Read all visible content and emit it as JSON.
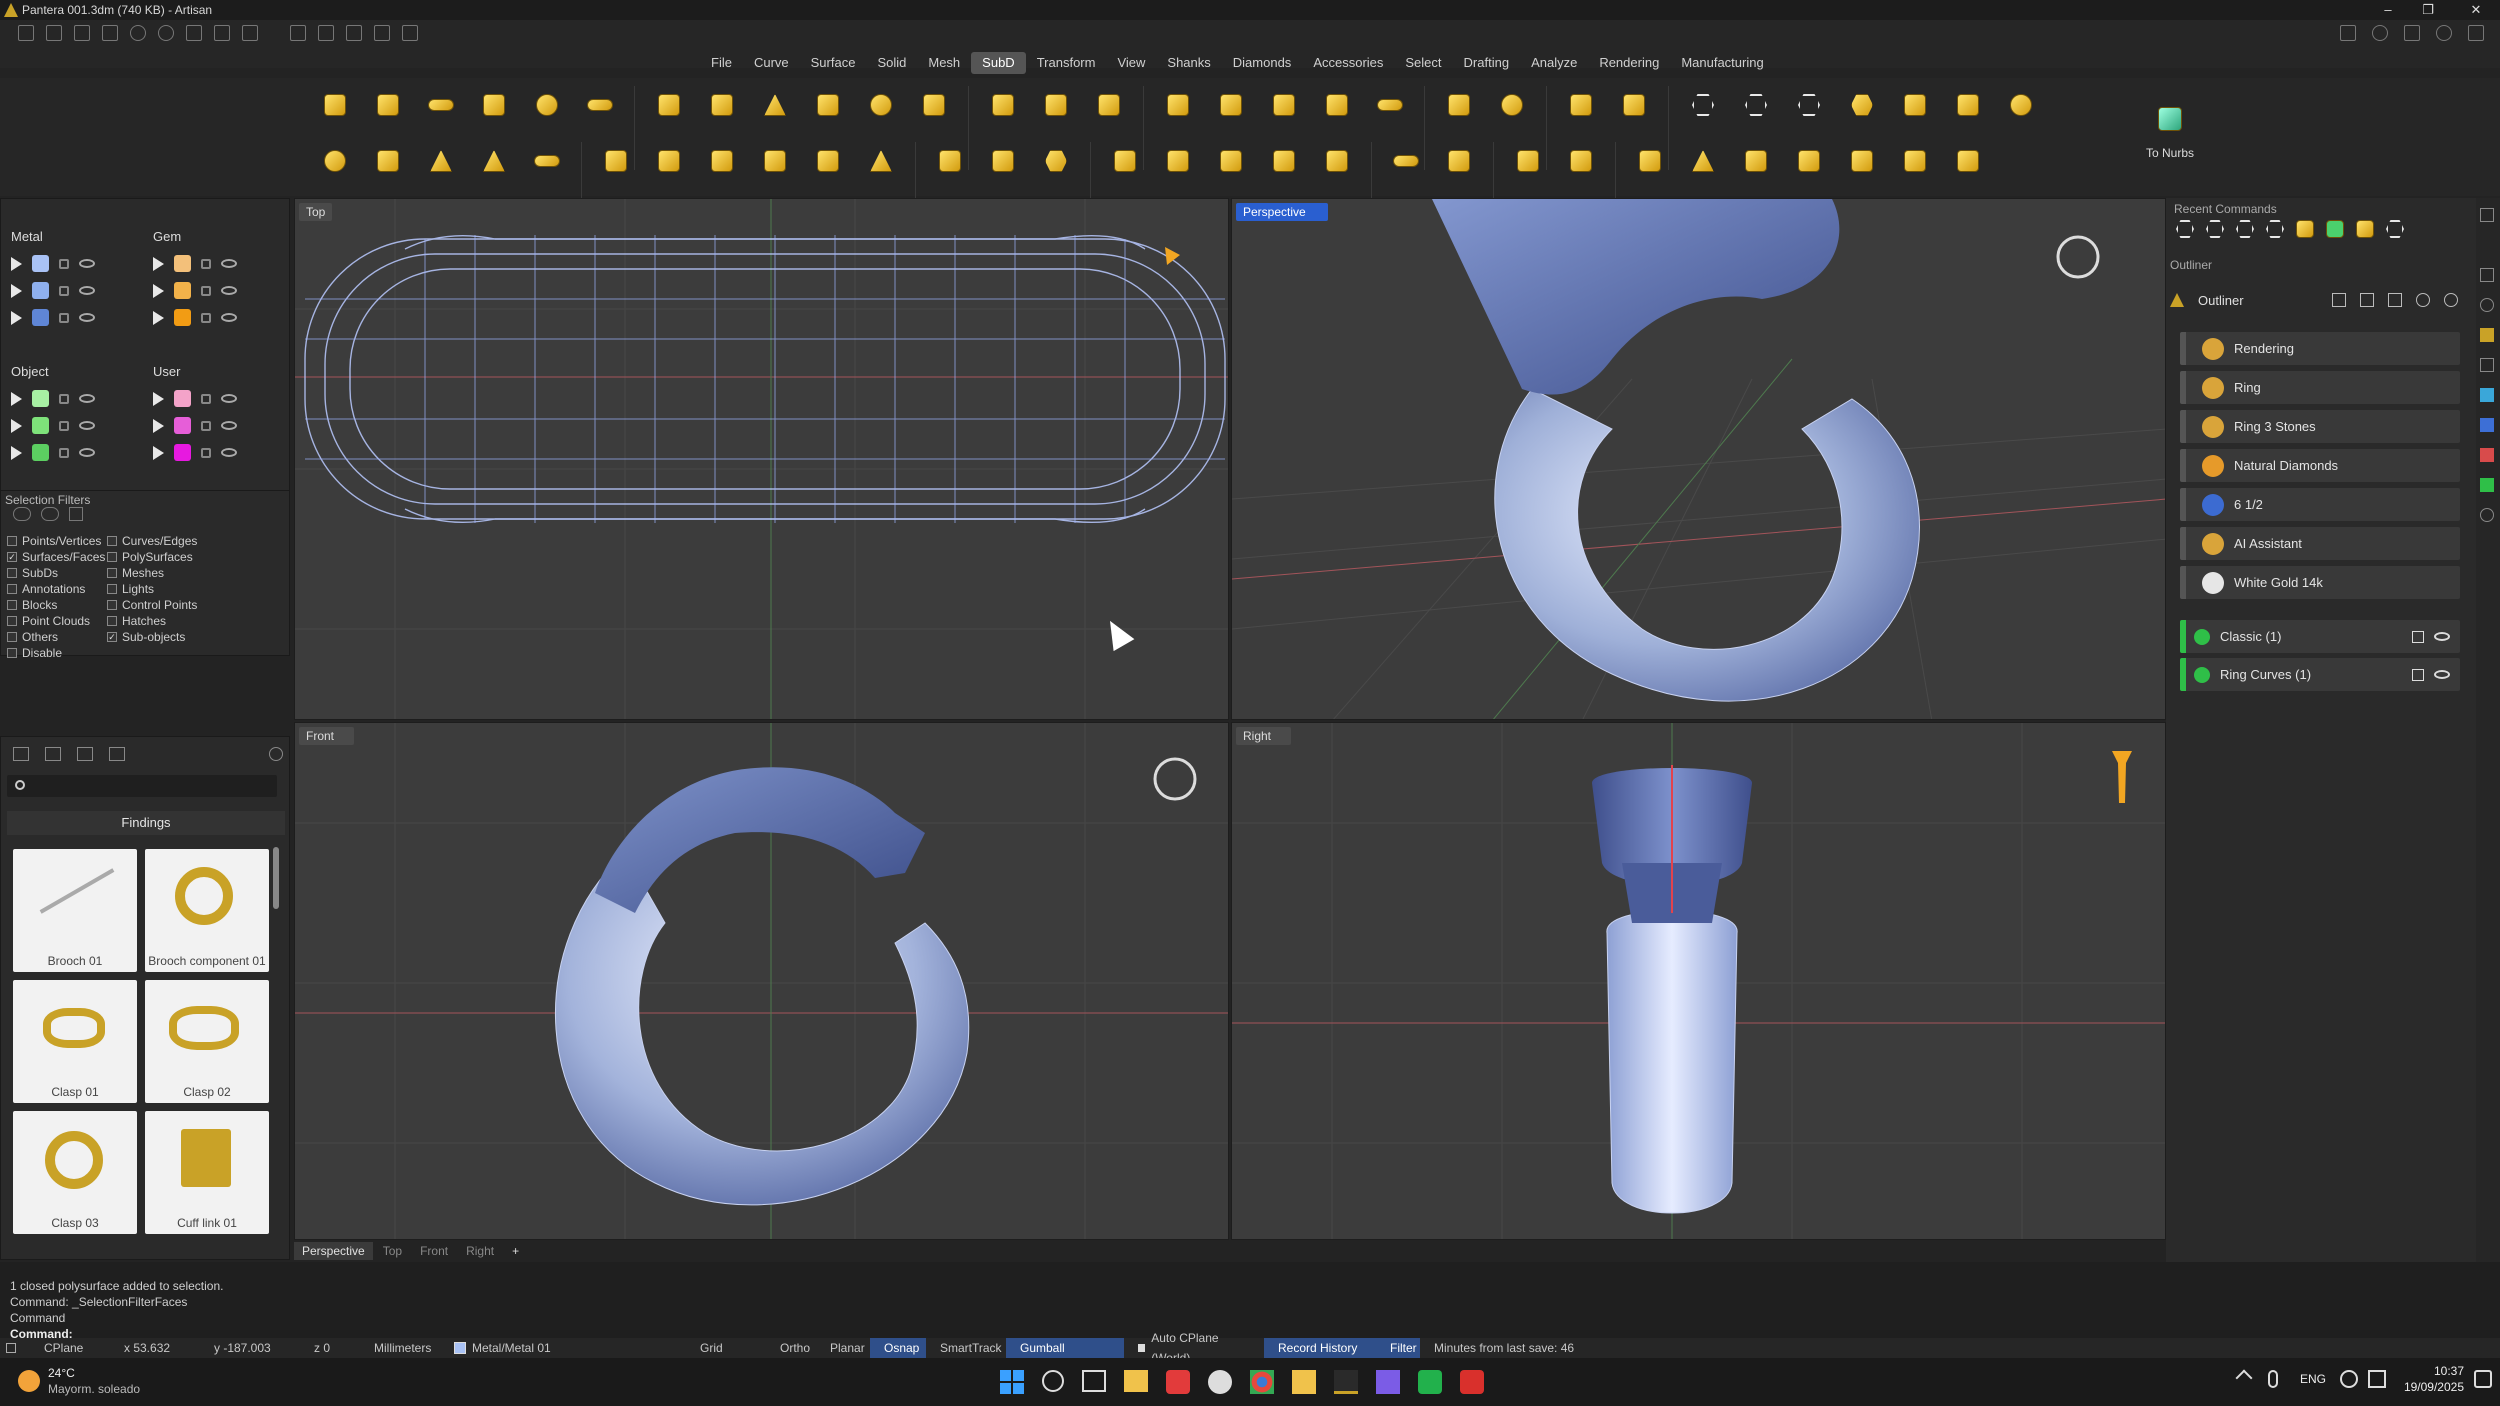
{
  "app": {
    "title": "Pantera 001.3dm (740 KB) - Artisan",
    "window_controls": [
      "–",
      "❐",
      "✕"
    ]
  },
  "menu": {
    "items": [
      "File",
      "Curve",
      "Surface",
      "Solid",
      "Mesh",
      "SubD",
      "Transform",
      "View",
      "Shanks",
      "Diamonds",
      "Accessories",
      "Select",
      "Drafting",
      "Analyze",
      "Rendering",
      "Manufacturing"
    ],
    "active": "SubD"
  },
  "ribbon": {
    "to_nurbs_label": "To Nurbs"
  },
  "layers": {
    "metal": {
      "title": "Metal",
      "swatches": [
        "#a9c2f5",
        "#8fb0ee",
        "#5f86d6"
      ]
    },
    "gem": {
      "title": "Gem",
      "swatches": [
        "#f3c07a",
        "#f2b24a",
        "#f29c14"
      ]
    },
    "object": {
      "title": "Object",
      "swatches": [
        "#a7f0a3",
        "#7ee27a",
        "#5ccf61"
      ]
    },
    "user": {
      "title": "User",
      "swatches": [
        "#f4a3c9",
        "#e65ed8",
        "#e719e0"
      ]
    }
  },
  "selection_filters": {
    "title": "Selection Filters",
    "left": [
      {
        "label": "Points/Vertices",
        "checked": false
      },
      {
        "label": "Surfaces/Faces",
        "checked": true
      },
      {
        "label": "SubDs",
        "checked": false
      },
      {
        "label": "Annotations",
        "checked": false
      },
      {
        "label": "Blocks",
        "checked": false
      },
      {
        "label": "Point Clouds",
        "checked": false
      },
      {
        "label": "Others",
        "checked": false
      },
      {
        "label": "Disable",
        "checked": false
      }
    ],
    "right": [
      {
        "label": "Curves/Edges",
        "checked": false
      },
      {
        "label": "PolySurfaces",
        "checked": false
      },
      {
        "label": "Meshes",
        "checked": false
      },
      {
        "label": "Lights",
        "checked": false
      },
      {
        "label": "Control Points",
        "checked": false
      },
      {
        "label": "Hatches",
        "checked": false
      },
      {
        "label": "Sub-objects",
        "checked": true
      }
    ]
  },
  "library": {
    "category": "Findings",
    "items": [
      {
        "label": "Brooch 01"
      },
      {
        "label": "Brooch component 01"
      },
      {
        "label": "Clasp 01"
      },
      {
        "label": "Clasp 02"
      },
      {
        "label": "Clasp 03"
      },
      {
        "label": "Cuff link 01"
      }
    ]
  },
  "viewports": {
    "top": "Top",
    "perspective": "Perspective",
    "front": "Front",
    "right": "Right"
  },
  "viewport_tabs": [
    "Perspective",
    "Top",
    "Front",
    "Right",
    "+"
  ],
  "recent_commands": {
    "title": "Recent Commands"
  },
  "outliner": {
    "section": "Outliner",
    "title": "Outliner",
    "items": [
      {
        "label": "Rendering",
        "icon_color": "#d9a43a"
      },
      {
        "label": "Ring",
        "icon_color": "#d9a43a"
      },
      {
        "label": "Ring 3 Stones",
        "icon_color": "#d9a43a"
      },
      {
        "label": "Natural Diamonds",
        "icon_color": "#e69a2a"
      },
      {
        "label": "6 1/2",
        "icon_color": "#3c6bd1"
      },
      {
        "label": "AI Assistant",
        "icon_color": "#d9a43a"
      },
      {
        "label": "White Gold 14k",
        "icon_color": "#e6e6e6"
      }
    ],
    "objects": [
      {
        "label": "Classic (1)"
      },
      {
        "label": "Ring Curves (1)"
      }
    ]
  },
  "command": {
    "history": [
      "1 closed polysurface added to selection.",
      "Command: _SelectionFilterFaces",
      "Command"
    ],
    "prompt": "Command:"
  },
  "status": {
    "cplane": "CPlane",
    "x": "x 53.632",
    "y": "y -187.003",
    "z": "z 0",
    "units": "Millimeters",
    "layer": "Metal/Metal 01",
    "toggles": [
      {
        "label": "Grid Snap",
        "on": false
      },
      {
        "label": "Ortho",
        "on": false
      },
      {
        "label": "Planar",
        "on": false
      },
      {
        "label": "Osnap",
        "on": true
      },
      {
        "label": "SmartTrack",
        "on": false
      },
      {
        "label": "Gumball (CPlane)",
        "on": true
      },
      {
        "label": "Auto CPlane (World)",
        "on": false
      },
      {
        "label": "Record History",
        "on": true
      },
      {
        "label": "Filter",
        "on": true
      }
    ],
    "save_note": "Minutes from last save: 46"
  },
  "taskbar": {
    "weather_temp": "24°C",
    "weather_desc": "Mayorm. soleado",
    "lang": "ENG",
    "time": "10:37",
    "date": "19/09/2025"
  }
}
